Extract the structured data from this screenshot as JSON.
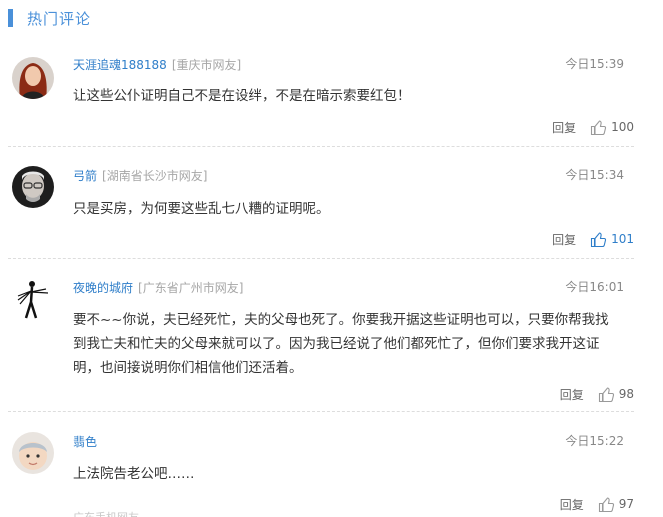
{
  "header": {
    "title": "热门评论"
  },
  "comments": [
    {
      "username": "天涯追魂188188",
      "location": "[重庆市网友]",
      "time": "今日15:39",
      "lines": [
        "让这些公仆证明自己不是在设绊，不是在暗示索要红包！"
      ],
      "reply_label": "回复",
      "likes": "100"
    },
    {
      "username": "弓箭",
      "location": "[湖南省长沙市网友]",
      "time": "今日15:34",
      "lines": [
        "只是买房，为何要这些乱七八糟的证明呢。"
      ],
      "reply_label": "回复",
      "likes": "101"
    },
    {
      "username": "夜晚的城府",
      "location": "[广东省广州市网友]",
      "time": "今日16:01",
      "lines": [
        "要不~~你说，夫已经死忙，夫的父母也死了。你要我开据这些证明也可以，只要你帮我找",
        "到我亡夫和忙夫的父母来就可以了。因为我已经说了他们都死忙了，但你们要求我开这证",
        "明，也间接说明你们相信他们还活着。"
      ],
      "reply_label": "回复",
      "likes": "98"
    },
    {
      "username": "翡色",
      "location": "",
      "time": "今日15:22",
      "lines": [
        "上法院告老公吧……"
      ],
      "reply_label": "回复",
      "likes": "97"
    }
  ],
  "footer": {
    "partial_text": "广东手机网友"
  },
  "colors": {
    "accent": "#4a90d9",
    "username": "#2f7ec9",
    "muted": "#a6a6a6"
  }
}
